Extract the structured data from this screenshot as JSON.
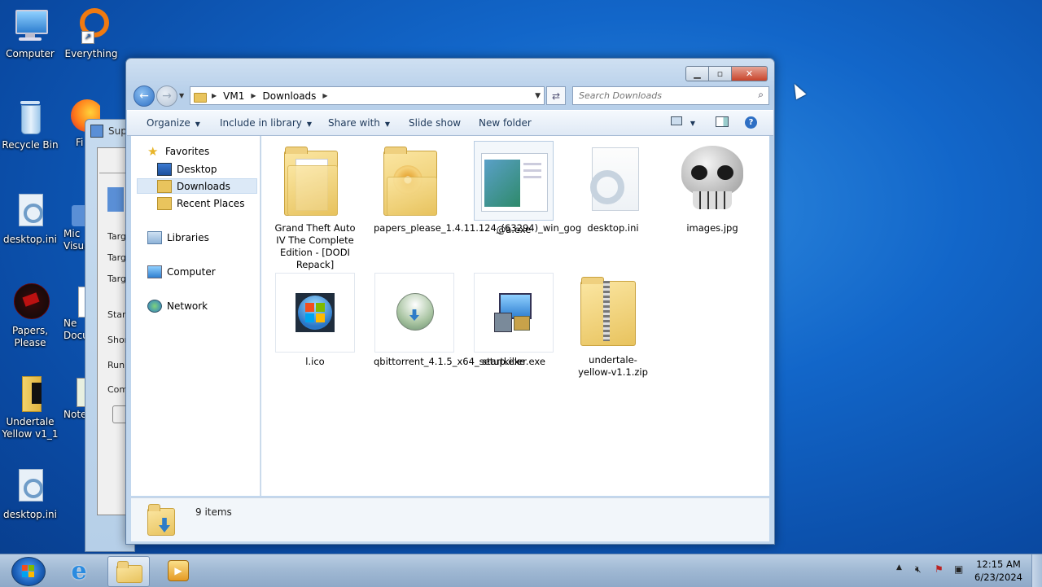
{
  "desktop": {
    "icons": [
      {
        "label": "Computer",
        "icon": "computer-icon"
      },
      {
        "label": "Everything",
        "icon": "everything-icon"
      },
      {
        "label": "Recycle Bin",
        "icon": "recycle-bin-icon"
      },
      {
        "label": "Fi",
        "icon": "firefox-icon"
      },
      {
        "label": "desktop.ini",
        "icon": "settings-file-icon"
      },
      {
        "label": "Mic Visua",
        "icon": "visual-studio-icon"
      },
      {
        "label": "Papers, Please",
        "icon": "papers-please-icon"
      },
      {
        "label": "Ne Docu",
        "icon": "document-icon"
      },
      {
        "label": "Undertale Yellow v1_1",
        "icon": "folder-icon"
      },
      {
        "label": "Note",
        "icon": "notepad-icon"
      },
      {
        "label": "desktop.ini",
        "icon": "settings-file-icon"
      }
    ]
  },
  "background_window": {
    "title": "Sup",
    "labels": [
      "Targ",
      "Targ",
      "Targ",
      "Start",
      "Shor",
      "Run",
      "Com"
    ]
  },
  "window": {
    "address": {
      "segments": [
        "VM1",
        "Downloads"
      ]
    },
    "search_placeholder": "Search Downloads",
    "toolbar": {
      "organize": "Organize",
      "include_in_library": "Include in library",
      "share_with": "Share with",
      "slide_show": "Slide show",
      "new_folder": "New folder"
    },
    "nav": {
      "favorites": "Favorites",
      "desktop": "Desktop",
      "downloads": "Downloads",
      "recent_places": "Recent Places",
      "libraries": "Libraries",
      "computer": "Computer",
      "network": "Network"
    },
    "files": [
      {
        "name": "Grand Theft Auto IV The Complete Edition - [DODI Repack]",
        "icon": "folder-icon"
      },
      {
        "name": "papers_please_1.4.11.124_(63294)_win_gog",
        "icon": "folder-disc-icon"
      },
      {
        "name": "@a.exe",
        "icon": "exe-window-icon"
      },
      {
        "name": "desktop.ini",
        "icon": "settings-file-icon"
      },
      {
        "name": "images.jpg",
        "icon": "skull-image-icon"
      },
      {
        "name": "l.ico",
        "icon": "windows-orb-icon"
      },
      {
        "name": "qbittorrent_4.1.5_x64_setup.exe",
        "icon": "installer-icon"
      },
      {
        "name": "startkiller.exe",
        "icon": "setup-computer-icon"
      },
      {
        "name": "undertale-yellow-v1.1.zip",
        "icon": "zip-folder-icon"
      }
    ],
    "status": {
      "count": "9 items"
    }
  },
  "taskbar": {
    "time": "12:15 AM",
    "date": "6/23/2024"
  },
  "colors": {
    "desktop": "#1266c9",
    "selection": "#dce9f7",
    "window_frame": "#b8d0ea",
    "close_button": "#c8442a"
  }
}
